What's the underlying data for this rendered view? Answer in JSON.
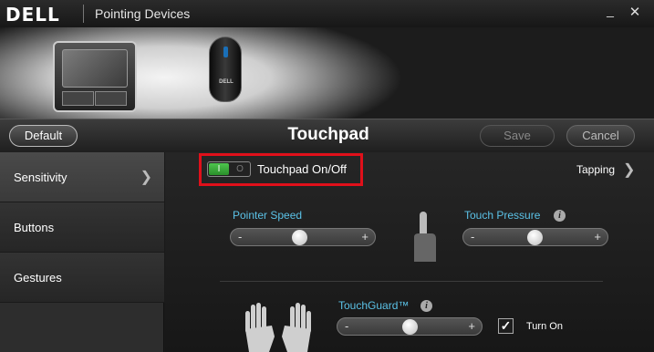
{
  "app": {
    "brand": "DELL",
    "title": "Pointing Devices",
    "minimize_glyph": "_",
    "close_glyph": "✕"
  },
  "devices": {
    "mouse_logo": "DELL"
  },
  "toolbar": {
    "default_label": "Default",
    "page_title": "Touchpad",
    "save_label": "Save",
    "cancel_label": "Cancel"
  },
  "sidebar": {
    "items": [
      {
        "label": "Sensitivity",
        "active": true
      },
      {
        "label": "Buttons"
      },
      {
        "label": "Gestures"
      }
    ]
  },
  "main": {
    "toggle": {
      "on_text": "I",
      "off_text": "O",
      "label": "Touchpad On/Off",
      "state": "on"
    },
    "tapping_label": "Tapping",
    "pointer_speed": {
      "label": "Pointer Speed",
      "minus": "-",
      "plus": "+",
      "level": 0.48
    },
    "touch_pressure": {
      "label": "Touch Pressure",
      "minus": "-",
      "plus": "+",
      "level": 0.5
    },
    "touchguard": {
      "label": "TouchGuard™",
      "minus": "-",
      "plus": "+",
      "level": 0.52,
      "checkbox_label": "Turn On",
      "checked": true
    }
  },
  "colors": {
    "highlight": "#e0101a",
    "accent_label": "#5bc2e7",
    "toggle_on": "#3aa83a"
  }
}
